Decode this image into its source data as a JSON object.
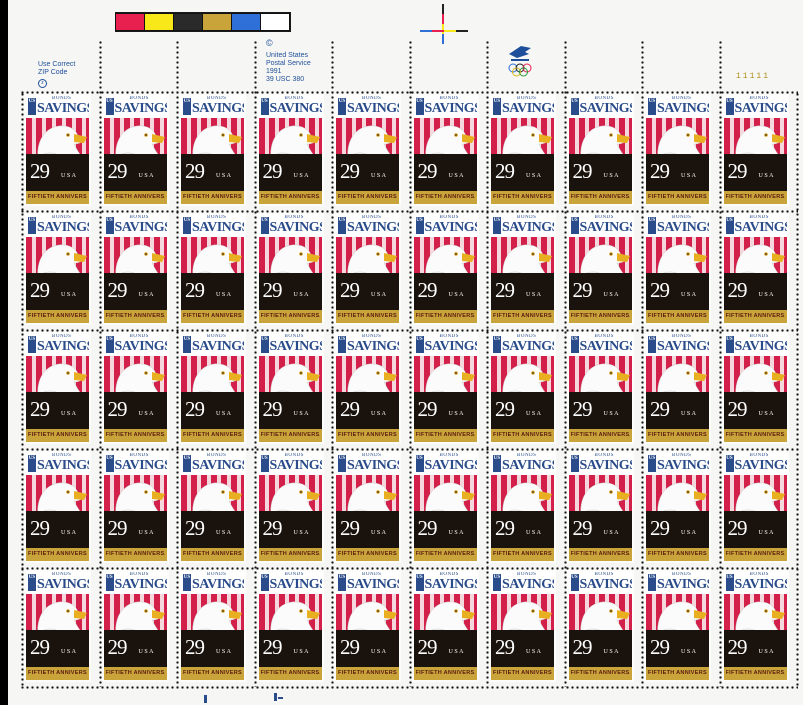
{
  "sheet": {
    "color_swatches": [
      "#e8204f",
      "#f8e81a",
      "#2a2a2a",
      "#c9a43a",
      "#2f6fd8",
      "#ffffff"
    ],
    "zip_text": [
      "Use Correct",
      "ZIP Code"
    ],
    "copyright_mark": "©",
    "usps_text": [
      "United States",
      "Postal Service",
      "1991",
      "39 USC 380"
    ],
    "plate_numbers": "11111",
    "usps_logo_icon": "usps-eagle-olympic-rings-icon"
  },
  "stamp": {
    "us_label": "US",
    "bonds_label": "BONDS",
    "savings_label": "SAVINGS",
    "denomination": "29",
    "country": "USA",
    "anniversary": "FIFTIETH ANNIVERSARY"
  },
  "grid": {
    "rows": 5,
    "columns": 10
  },
  "colors": {
    "stamp_blue": "#2a4c8a",
    "flag_red": "#d2204a",
    "banner_gold": "#c9a43a",
    "margin_blue": "#1f4f9a"
  }
}
